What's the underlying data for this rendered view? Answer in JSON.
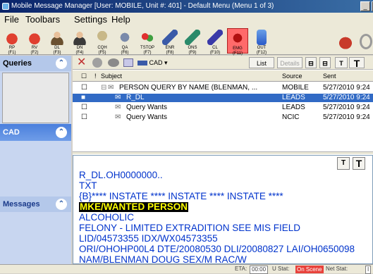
{
  "window": {
    "title": "Mobile Message Manager [User: MOBILE, Unit #: 401] - Default Menu (Menu 1 of 3)"
  },
  "menubar": {
    "items": [
      "File",
      "Toolbars",
      "Settings",
      "Help"
    ]
  },
  "toolbar": {
    "buttons": [
      {
        "label": "RP",
        "key": "(F1)",
        "icon": "red-car-icon",
        "color": "#c83a2a"
      },
      {
        "label": "RV",
        "key": "(F2)",
        "icon": "red-car-icon",
        "color": "#c83a2a"
      },
      {
        "label": "DL",
        "key": "(F3)",
        "icon": "person-icon",
        "color": "#6a5030"
      },
      {
        "label": "DN",
        "key": "(F4)",
        "icon": "person-icon",
        "color": "#3a3a3a"
      },
      {
        "label": "CQH",
        "key": "(F5)",
        "icon": "person-query-icon",
        "color": "#8a7a50"
      },
      {
        "label": "QA",
        "key": "(F6)",
        "icon": "gears-icon",
        "color": "#5a6a8a"
      },
      {
        "label": "TSTOP",
        "key": "(F7)",
        "icon": "traffic-light-icon",
        "color": "#4a8a3a"
      },
      {
        "label": "ENR",
        "key": "(F8)",
        "icon": "enroute-icon",
        "color": "#3a5aa8"
      },
      {
        "label": "ONS",
        "key": "(F9)",
        "icon": "onscene-icon",
        "color": "#2a8a6a"
      },
      {
        "label": "CL",
        "key": "(F10)",
        "icon": "clear-icon",
        "color": "#3a3aa8"
      },
      {
        "label": "EMG",
        "key": "(F11)",
        "icon": "emergency-icon",
        "color": "#d02020"
      },
      {
        "label": "OUT",
        "key": "(F12)",
        "icon": "out-icon",
        "color": "#3a7ad8"
      }
    ]
  },
  "sidebar": {
    "queries": "Queries",
    "cad": "CAD",
    "messages": "Messages"
  },
  "main_toolbar": {
    "cad_label": "CAD",
    "list_label": "List",
    "details_label": "Details",
    "t_small": "T",
    "t_large": "T"
  },
  "grid": {
    "headers": {
      "check": "☐",
      "flag": "!",
      "subject": "Subject",
      "source": "Source",
      "sent": "Sent"
    },
    "rows": [
      {
        "subject": "PERSON QUERY BY NAME (BLENMAN, ...",
        "source": "MOBILE",
        "sent": "5/27/2010 9:24"
      },
      {
        "subject": "R_DL",
        "source": "LEADS",
        "sent": "5/27/2010 9:24"
      },
      {
        "subject": "Query Wants",
        "source": "LEADS",
        "sent": "5/27/2010 9:24"
      },
      {
        "subject": "Query Wants",
        "source": "NCIC",
        "sent": "5/27/2010 9:24"
      }
    ]
  },
  "message": {
    "lines": [
      "R_DL.OH0000000..",
      "TXT",
      "{B}**** INSTATE **** INSTATE **** INSTATE ****",
      "MKE/WANTED PERSON",
      "ALCOHOLIC",
      "FELONY - LIMITED EXTRADITION SEE MIS FIELD",
      "LID/04573355 IDX/WX04573355",
      "ORI/OHOHP00L4 DTE/20080530 DLI/20080827 LAI/OH0650098",
      "NAM/BLENMAN DOUG SEX/M RAC/W"
    ],
    "t_small": "T",
    "t_large": "T"
  },
  "statusbar": {
    "eta_label": "ETA:",
    "eta_value": "00:00",
    "ui_stat_label": "U Stat:",
    "ui_stat_value": "On Scene",
    "net_stat_label": "Net Stat:",
    "net_stat_value": "I"
  }
}
